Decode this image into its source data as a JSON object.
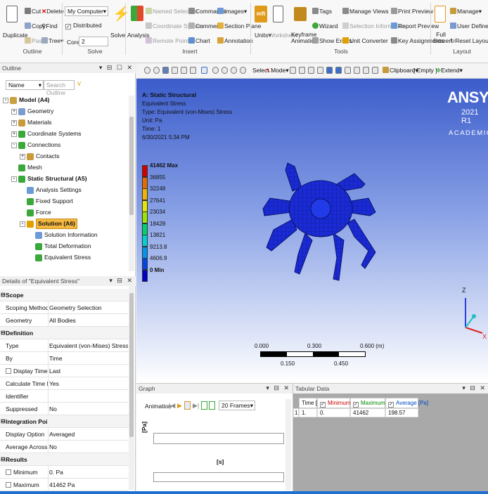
{
  "ribbon": {
    "duplicate": "Duplicate",
    "cut": "Cut",
    "copy": "Copy",
    "paste": "Paste",
    "delete": "Delete",
    "find": "Find",
    "tree": "Tree",
    "outline_group": "Outline",
    "computer_select": "My Computer",
    "distributed": "Distributed",
    "cores_label": "Cores",
    "cores_value": "2",
    "solve": "Solve",
    "solve_group": "Solve",
    "analysis": "Analysis",
    "named_selection": "Named Selection",
    "coordinate_system": "Coordinate System",
    "remote_point": "Remote Point",
    "commands": "Commands",
    "comment": "Comment",
    "chart": "Chart",
    "images": "Images",
    "section_plane": "Section Plane",
    "annotation": "Annotation",
    "insert_group": "Insert",
    "units": "Units",
    "worksheet": "Worksheet",
    "keyframe_animation": "Keyframe Animation",
    "tags": "Tags",
    "wizard": "Wizard",
    "show_errors": "Show Errors",
    "manage_views": "Manage Views",
    "selection_information": "Selection Information",
    "unit_converter": "Unit Converter",
    "print_preview": "Print Preview",
    "report_preview": "Report Preview",
    "key_assignments": "Key Assignments",
    "tools_group": "Tools",
    "full_screen": "Full Screen",
    "manage": "Manage",
    "user_defined": "User Defined",
    "reset_layout": "Reset Layout",
    "layout_group": "Layout",
    "mft_icon_text": "mft"
  },
  "outline": {
    "title": "Outline",
    "name_select": "Name",
    "search_placeholder": "Search Outline",
    "items": [
      {
        "label": "Model (A4)"
      },
      {
        "label": "Geometry"
      },
      {
        "label": "Materials"
      },
      {
        "label": "Coordinate Systems"
      },
      {
        "label": "Connections"
      },
      {
        "label": "Contacts"
      },
      {
        "label": "Mesh"
      },
      {
        "label": "Static Structural (A5)"
      },
      {
        "label": "Analysis Settings"
      },
      {
        "label": "Fixed Support"
      },
      {
        "label": "Force"
      },
      {
        "label": "Solution (A6)"
      },
      {
        "label": "Solution Information"
      },
      {
        "label": "Total Deformation"
      },
      {
        "label": "Equivalent Stress"
      }
    ]
  },
  "details": {
    "title": "Details of \"Equivalent Stress\"",
    "rows": [
      {
        "k": "Scope",
        "v": "",
        "cat": true
      },
      {
        "k": "Scoping Method",
        "v": "Geometry Selection"
      },
      {
        "k": "Geometry",
        "v": "All Bodies"
      },
      {
        "k": "Definition",
        "v": "",
        "cat": true
      },
      {
        "k": "Type",
        "v": "Equivalent (von-Mises) Stress"
      },
      {
        "k": "By",
        "v": "Time"
      },
      {
        "k": "Display Time",
        "v": "Last"
      },
      {
        "k": "Calculate Time History",
        "v": "Yes"
      },
      {
        "k": "Identifier",
        "v": ""
      },
      {
        "k": "Suppressed",
        "v": "No"
      },
      {
        "k": "Integration Point Results",
        "v": "",
        "cat": true
      },
      {
        "k": "Display Option",
        "v": "Averaged"
      },
      {
        "k": "Average Across Bodies",
        "v": "No"
      },
      {
        "k": "Results",
        "v": "",
        "cat": true
      },
      {
        "k": "Minimum",
        "v": "0. Pa"
      },
      {
        "k": "Maximum",
        "v": "41462 Pa"
      }
    ]
  },
  "viewport_toolbar": {
    "select": "Select",
    "mode": "Mode",
    "clipboard": "Clipboard",
    "empty": "[ Empty ]",
    "extend": "Extend"
  },
  "viewport": {
    "title": "A: Static Structural",
    "line1": "Equivalent Stress",
    "line2": "Type: Equivalent (von-Mises) Stress",
    "line3": "Unit: Pa",
    "line4": "Time: 1",
    "line5": "6/30/2021 5:34 PM",
    "brand": "ANSYS",
    "version": "2021 R1",
    "edition": "ACADEMIC",
    "legend": [
      {
        "label": "41462 Max",
        "color": "#d40000"
      },
      {
        "label": "36855",
        "color": "#e66b00"
      },
      {
        "label": "32248",
        "color": "#f2b400"
      },
      {
        "label": "27641",
        "color": "#e6e600"
      },
      {
        "label": "23034",
        "color": "#9be600"
      },
      {
        "label": "18428",
        "color": "#00d26e"
      },
      {
        "label": "13821",
        "color": "#00d2d2"
      },
      {
        "label": "9213.8",
        "color": "#0096f0"
      },
      {
        "label": "4606.9",
        "color": "#0046e6"
      },
      {
        "label": "0 Min",
        "color": "#0000c8"
      }
    ],
    "scale_labels": [
      "0.000",
      "0.300",
      "0.600 (m)"
    ],
    "scale_sub": [
      "0.150",
      "0.450"
    ],
    "axis_z": "Z",
    "axis_x": "X"
  },
  "graph": {
    "title": "Graph",
    "animation": "Animation",
    "frames": "20 Frames",
    "ylabel": "[Pa]",
    "xlabel": "[s]"
  },
  "tabular": {
    "title": "Tabular Data",
    "headers": [
      "Time [s]",
      "Minimum [Pa]",
      "Maximum [Pa]",
      "Average [Pa]"
    ],
    "row": [
      "1",
      "1.",
      "0.",
      "41462",
      "198.57"
    ]
  }
}
